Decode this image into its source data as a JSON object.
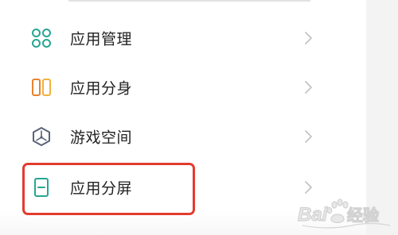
{
  "settings_list": {
    "items": [
      {
        "label": "应用管理",
        "icon": "app-management-icon"
      },
      {
        "label": "应用分身",
        "icon": "app-clone-icon"
      },
      {
        "label": "游戏空间",
        "icon": "game-space-icon"
      },
      {
        "label": "应用分屏",
        "icon": "split-screen-icon"
      }
    ]
  },
  "watermark": {
    "text": "Baidu经验"
  },
  "colors": {
    "highlight": "#e23b2e",
    "teal": "#26a693",
    "orange": "#e8832f",
    "game_icon": "#5a6378"
  }
}
